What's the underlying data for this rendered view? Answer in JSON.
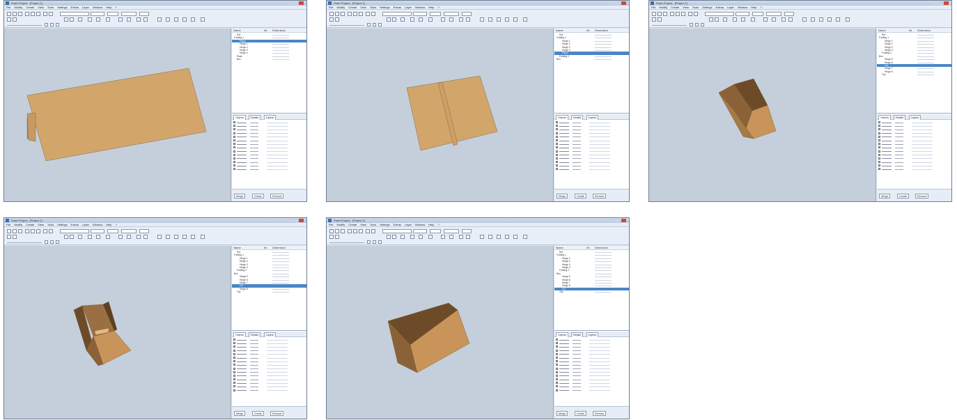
{
  "screenshots": [
    {
      "title": "Flash Project - [Project 1]",
      "menu": [
        "File",
        "Modify",
        "Create",
        "View",
        "Tools",
        "Settings",
        "Extras",
        "Layer",
        "Window",
        "Help",
        "?"
      ],
      "tree_header": {
        "name": "Name",
        "nr": "Nr.",
        "dimension": "Dimension"
      },
      "tree_rows": [
        {
          "label": "Rot",
          "num": "",
          "value": "",
          "indent": 1,
          "selected": false
        },
        {
          "label": "Folding 1",
          "num": "",
          "value": "",
          "indent": 0,
          "selected": false
        },
        {
          "label": "Panel",
          "num": "",
          "value": "",
          "indent": 2,
          "selected": true
        },
        {
          "label": "Hinge 1",
          "num": "",
          "value": "",
          "indent": 2,
          "selected": false
        },
        {
          "label": "Hinge 2",
          "num": "",
          "value": "",
          "indent": 2,
          "selected": false
        },
        {
          "label": "Hinge 3",
          "num": "",
          "value": "",
          "indent": 2,
          "selected": false
        },
        {
          "label": "Hinge 4",
          "num": "",
          "value": "",
          "indent": 2,
          "selected": false
        },
        {
          "label": "Plate",
          "num": "",
          "value": "",
          "indent": 1,
          "selected": false
        },
        {
          "label": "Box",
          "num": "",
          "value": "",
          "indent": 1,
          "selected": false
        }
      ],
      "tabs": [
        "Objects",
        "Details",
        "Layers"
      ],
      "prop_rows": 14,
      "bottom_buttons": [
        "Merge",
        "Create",
        "Remove"
      ]
    },
    {
      "title": "Flash Project - [Project 1]",
      "menu": [
        "File",
        "Modify",
        "Create",
        "View",
        "Tools",
        "Settings",
        "Extras",
        "Layer",
        "Window",
        "Help",
        "?"
      ],
      "tree_header": {
        "name": "Name",
        "nr": "Nr.",
        "dimension": "Dimension"
      },
      "tree_rows": [
        {
          "label": "Rot",
          "num": "",
          "value": "",
          "indent": 1,
          "selected": false
        },
        {
          "label": "Folding 1",
          "num": "",
          "value": "",
          "indent": 0,
          "selected": false
        },
        {
          "label": "Hinge 1",
          "num": "",
          "value": "",
          "indent": 2,
          "selected": false
        },
        {
          "label": "Hinge 2",
          "num": "",
          "value": "",
          "indent": 2,
          "selected": false
        },
        {
          "label": "Hinge 3",
          "num": "",
          "value": "",
          "indent": 2,
          "selected": false
        },
        {
          "label": "Hinge 4",
          "num": "",
          "value": "",
          "indent": 2,
          "selected": false
        },
        {
          "label": "Panel",
          "num": "",
          "value": "",
          "indent": 2,
          "selected": true
        },
        {
          "label": "Folding 2",
          "num": "",
          "value": "",
          "indent": 1,
          "selected": false
        },
        {
          "label": "Box",
          "num": "",
          "value": "",
          "indent": 0,
          "selected": false
        }
      ],
      "tabs": [
        "Objects",
        "Details",
        "Layers"
      ],
      "prop_rows": 14,
      "bottom_buttons": [
        "Merge",
        "Create",
        "Remove"
      ]
    },
    {
      "title": "Flash Project - [Project 1]",
      "menu": [
        "File",
        "Modify",
        "Create",
        "View",
        "Tools",
        "Settings",
        "Extras",
        "Layer",
        "Window",
        "Help",
        "?"
      ],
      "tree_header": {
        "name": "Name",
        "nr": "Nr.",
        "dimension": "Dimension"
      },
      "tree_rows": [
        {
          "label": "Rot",
          "num": "",
          "value": "",
          "indent": 1,
          "selected": false
        },
        {
          "label": "Folding 1",
          "num": "",
          "value": "",
          "indent": 0,
          "selected": false
        },
        {
          "label": "Hinge 1",
          "num": "",
          "value": "",
          "indent": 2,
          "selected": false
        },
        {
          "label": "Hinge 2",
          "num": "",
          "value": "",
          "indent": 2,
          "selected": false
        },
        {
          "label": "Hinge 3",
          "num": "",
          "value": "",
          "indent": 2,
          "selected": false
        },
        {
          "label": "Hinge 4",
          "num": "",
          "value": "",
          "indent": 2,
          "selected": false
        },
        {
          "label": "Folding 2",
          "num": "",
          "value": "",
          "indent": 1,
          "selected": false
        },
        {
          "label": "Box",
          "num": "",
          "value": "",
          "indent": 0,
          "selected": false
        },
        {
          "label": "Hinge 5",
          "num": "",
          "value": "",
          "indent": 2,
          "selected": false
        },
        {
          "label": "Hinge 6",
          "num": "",
          "value": "",
          "indent": 2,
          "selected": false
        },
        {
          "label": "Lid",
          "num": "",
          "value": "",
          "indent": 2,
          "selected": true
        },
        {
          "label": "Hinge 7",
          "num": "",
          "value": "",
          "indent": 2,
          "selected": false
        },
        {
          "label": "Hinge 8",
          "num": "",
          "value": "",
          "indent": 2,
          "selected": false
        },
        {
          "label": "Top",
          "num": "",
          "value": "",
          "indent": 1,
          "selected": false
        }
      ],
      "tabs": [
        "Objects",
        "Details",
        "Layers"
      ],
      "prop_rows": 14,
      "bottom_buttons": [
        "Merge",
        "Create",
        "Remove"
      ]
    },
    {
      "title": "Flash Project - [Project 1]",
      "menu": [
        "File",
        "Modify",
        "Create",
        "View",
        "Tools",
        "Settings",
        "Extras",
        "Layer",
        "Window",
        "Help",
        "?"
      ],
      "tree_header": {
        "name": "Name",
        "nr": "Nr.",
        "dimension": "Dimension"
      },
      "tree_rows": [
        {
          "label": "Rot",
          "num": "",
          "value": "",
          "indent": 1,
          "selected": false
        },
        {
          "label": "Folding 1",
          "num": "",
          "value": "",
          "indent": 0,
          "selected": false
        },
        {
          "label": "Hinge 1",
          "num": "",
          "value": "",
          "indent": 2,
          "selected": false
        },
        {
          "label": "Hinge 2",
          "num": "",
          "value": "",
          "indent": 2,
          "selected": false
        },
        {
          "label": "Hinge 3",
          "num": "",
          "value": "",
          "indent": 2,
          "selected": false
        },
        {
          "label": "Hinge 4",
          "num": "",
          "value": "",
          "indent": 2,
          "selected": false
        },
        {
          "label": "Folding 2",
          "num": "",
          "value": "",
          "indent": 1,
          "selected": false
        },
        {
          "label": "Box",
          "num": "",
          "value": "",
          "indent": 0,
          "selected": false
        },
        {
          "label": "Hinge 5",
          "num": "",
          "value": "",
          "indent": 2,
          "selected": false
        },
        {
          "label": "Hinge 6",
          "num": "",
          "value": "",
          "indent": 2,
          "selected": false
        },
        {
          "label": "Hinge 7",
          "num": "",
          "value": "",
          "indent": 2,
          "selected": false
        },
        {
          "label": "Lid",
          "num": "",
          "value": "",
          "indent": 2,
          "selected": true
        },
        {
          "label": "Hinge 8",
          "num": "",
          "value": "",
          "indent": 2,
          "selected": false
        },
        {
          "label": "Top",
          "num": "",
          "value": "",
          "indent": 1,
          "selected": false
        }
      ],
      "tabs": [
        "Objects",
        "Details",
        "Layers"
      ],
      "prop_rows": 15,
      "bottom_buttons": [
        "Merge",
        "Create",
        "Remove"
      ]
    },
    {
      "title": "Flash Project - [Project 1]",
      "menu": [
        "File",
        "Modify",
        "Create",
        "View",
        "Tools",
        "Settings",
        "Extras",
        "Layer",
        "Window",
        "Help",
        "?"
      ],
      "tree_header": {
        "name": "Name",
        "nr": "Nr.",
        "dimension": "Dimension"
      },
      "tree_rows": [
        {
          "label": "Rot",
          "num": "",
          "value": "",
          "indent": 1,
          "selected": false
        },
        {
          "label": "Folding 1",
          "num": "",
          "value": "",
          "indent": 0,
          "selected": false
        },
        {
          "label": "Hinge 1",
          "num": "",
          "value": "",
          "indent": 2,
          "selected": false
        },
        {
          "label": "Hinge 2",
          "num": "",
          "value": "",
          "indent": 2,
          "selected": false
        },
        {
          "label": "Hinge 3",
          "num": "",
          "value": "",
          "indent": 2,
          "selected": false
        },
        {
          "label": "Hinge 4",
          "num": "",
          "value": "",
          "indent": 2,
          "selected": false
        },
        {
          "label": "Folding 2",
          "num": "",
          "value": "",
          "indent": 1,
          "selected": false
        },
        {
          "label": "Box",
          "num": "",
          "value": "",
          "indent": 0,
          "selected": false
        },
        {
          "label": "Hinge 5",
          "num": "",
          "value": "",
          "indent": 2,
          "selected": false
        },
        {
          "label": "Hinge 6",
          "num": "",
          "value": "",
          "indent": 2,
          "selected": false
        },
        {
          "label": "Hinge 7",
          "num": "",
          "value": "",
          "indent": 2,
          "selected": false
        },
        {
          "label": "Hinge 8",
          "num": "",
          "value": "",
          "indent": 2,
          "selected": false
        },
        {
          "label": "Lid",
          "num": "",
          "value": "",
          "indent": 2,
          "selected": true
        },
        {
          "label": "Top",
          "num": "",
          "value": "",
          "indent": 1,
          "selected": false
        }
      ],
      "tabs": [
        "Objects",
        "Details",
        "Layers"
      ],
      "prop_rows": 15,
      "bottom_buttons": [
        "Merge",
        "Create",
        "Remove"
      ]
    }
  ],
  "colors": {
    "cardboard": "#d2a56b",
    "cardboard_dark": "#9c7446",
    "cardboard_shadow": "#7a5733",
    "viewport_bg": "#c4cfdb",
    "selection": "#4a86c8"
  }
}
